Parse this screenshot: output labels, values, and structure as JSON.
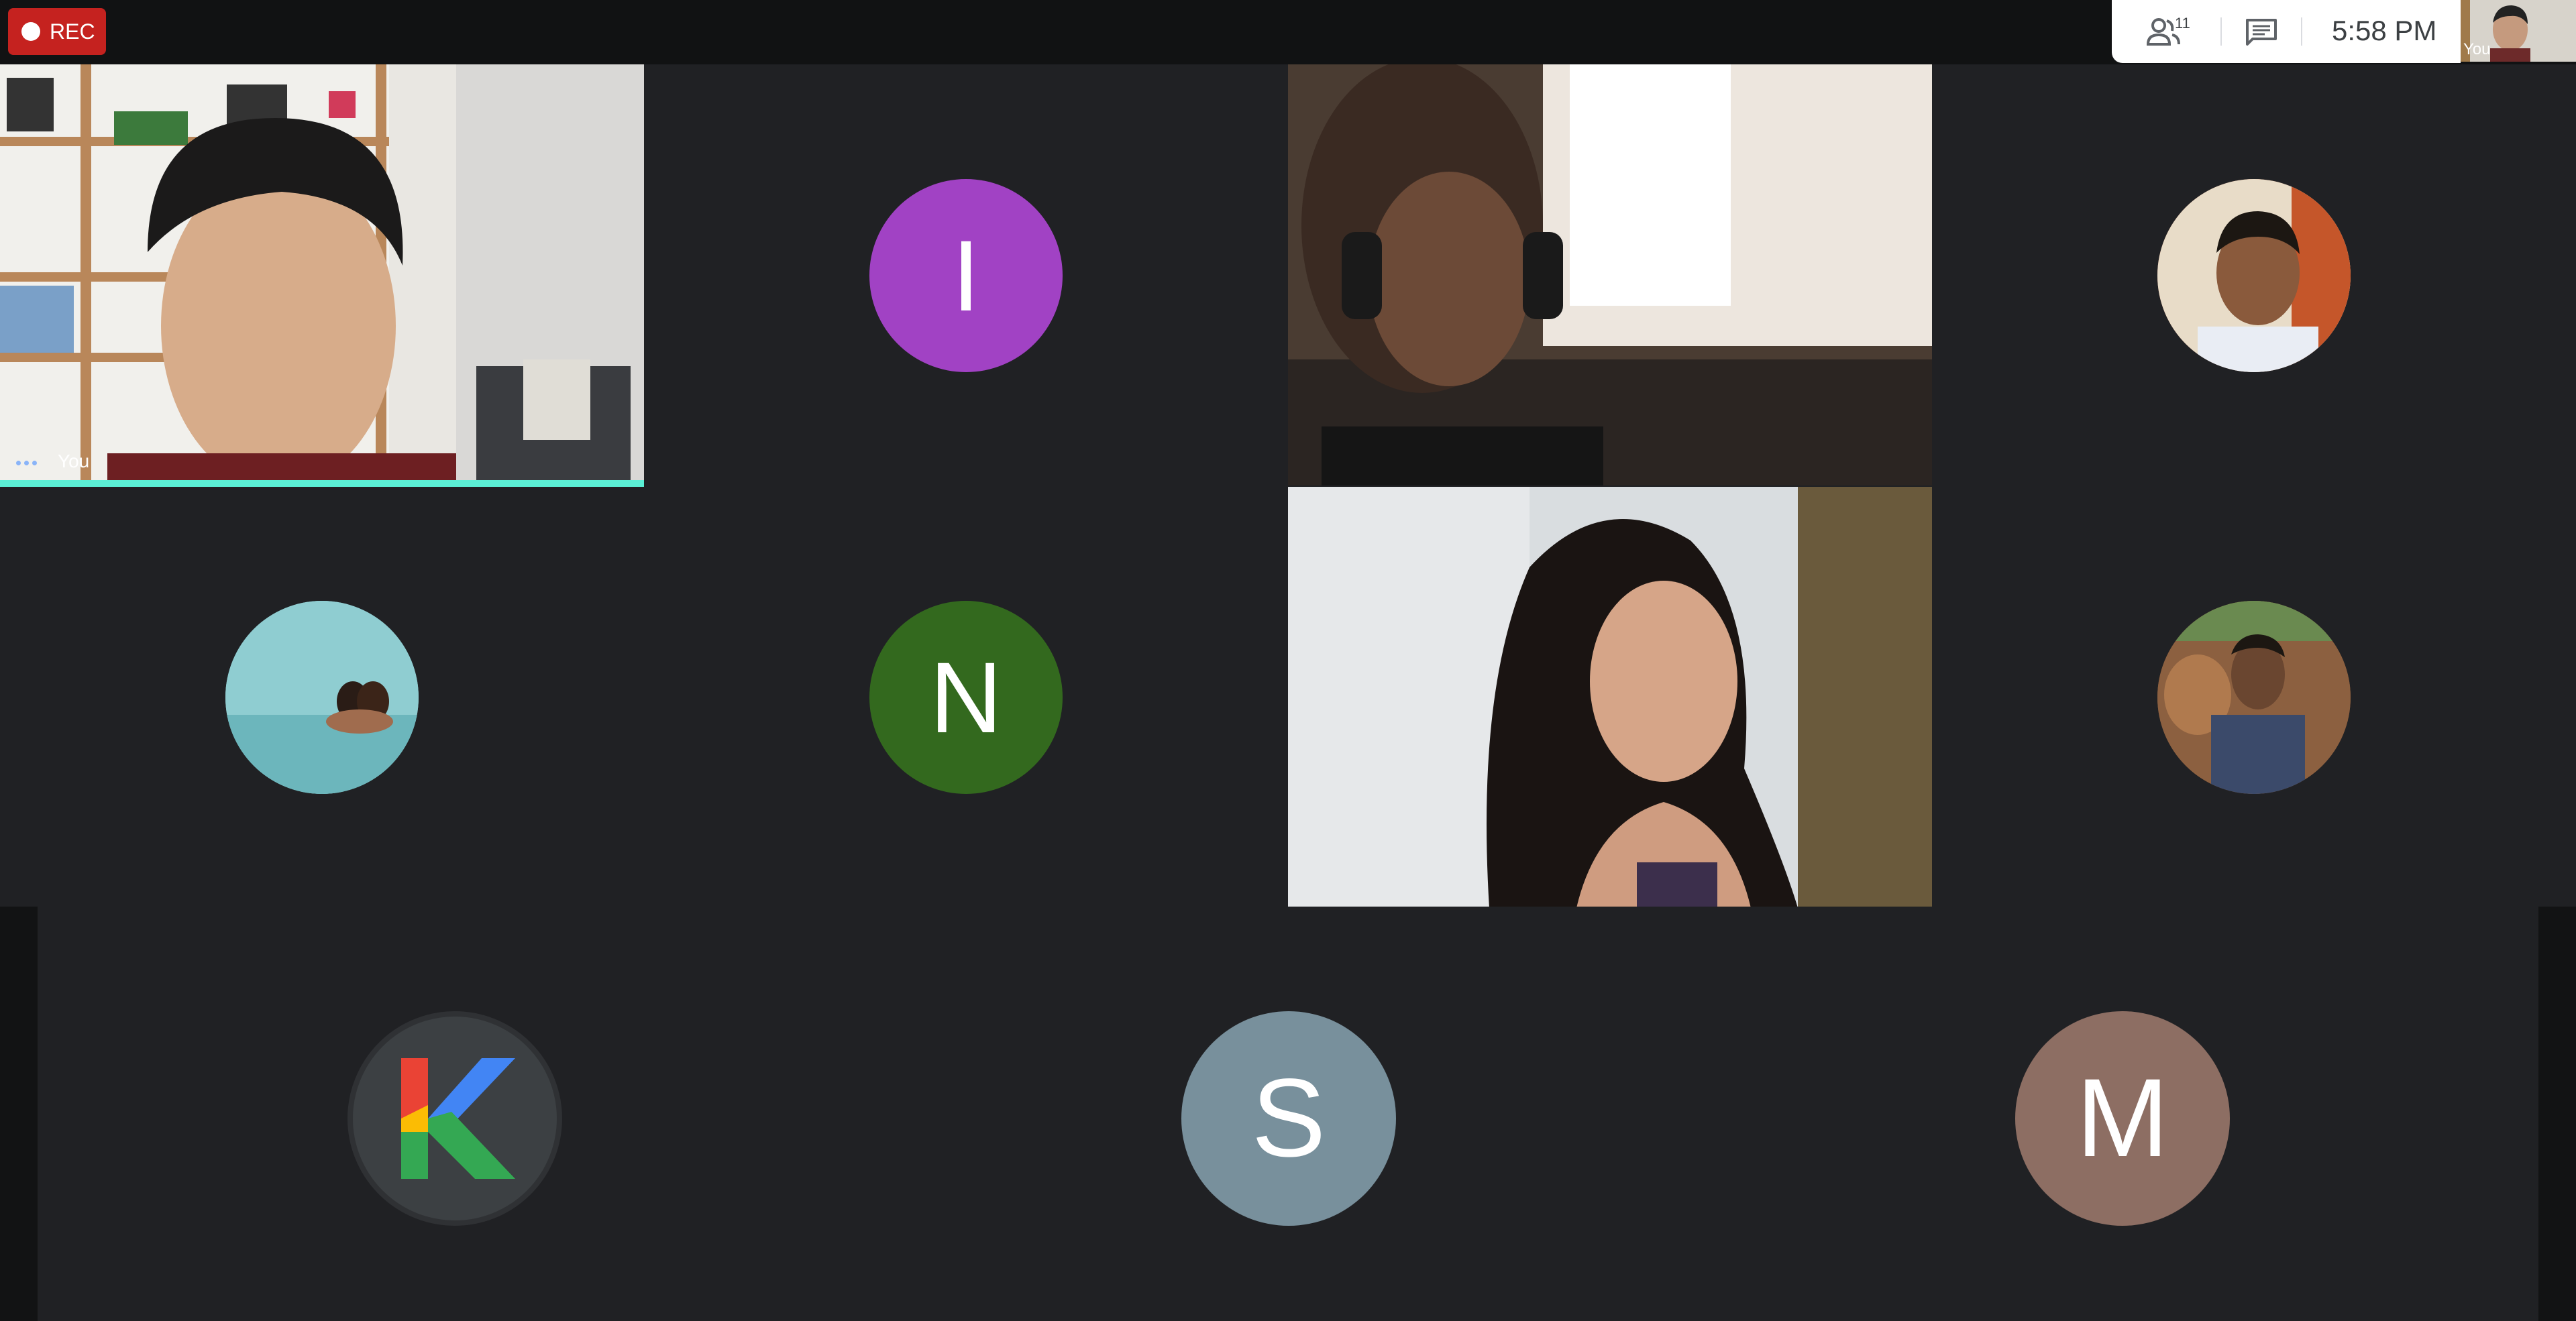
{
  "recording": {
    "label": "REC"
  },
  "info_bar": {
    "participant_count": "11",
    "time": "5:58 PM"
  },
  "self_thumbnail": {
    "label": "You"
  },
  "participants": [
    {
      "kind": "video",
      "label": "You",
      "speaking": true
    },
    {
      "kind": "initial",
      "initial": "I",
      "color": "#a142c4"
    },
    {
      "kind": "video",
      "label": ""
    },
    {
      "kind": "photo",
      "label": ""
    },
    {
      "kind": "photo",
      "label": ""
    },
    {
      "kind": "initial",
      "initial": "N",
      "color": "#33691e"
    },
    {
      "kind": "video",
      "label": ""
    },
    {
      "kind": "photo",
      "label": ""
    },
    {
      "kind": "logo",
      "initial": "K",
      "color": "#3c4043"
    },
    {
      "kind": "initial",
      "initial": "S",
      "color": "#78909c"
    },
    {
      "kind": "initial",
      "initial": "M",
      "color": "#8d6e63"
    }
  ],
  "colors": {
    "background": "#202124",
    "topbar": "#111213",
    "rec": "#c5221f",
    "speaking_indicator": "#5bf0d6"
  }
}
